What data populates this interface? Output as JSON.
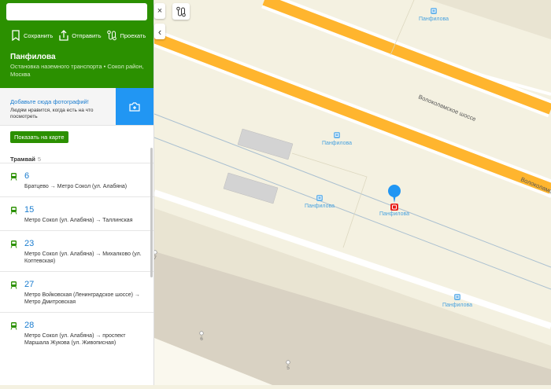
{
  "search": {
    "value": ""
  },
  "actions": [
    {
      "label": "Сохранить",
      "icon": "bookmark-icon"
    },
    {
      "label": "Отправить",
      "icon": "share-icon"
    },
    {
      "label": "Проехать",
      "icon": "route-icon"
    }
  ],
  "place": {
    "title": "Панфилова",
    "subtitle": "Остановка наземного транспорта • Сокол район, Москва"
  },
  "photo": {
    "title": "Добавьте сюда фотографий!",
    "text": "Людям нравится, когда есть на что посмотреть"
  },
  "show_on_map": "Показать на карте",
  "section": {
    "title": "Трамвай",
    "count": "5"
  },
  "routes": [
    {
      "number": "6",
      "direction": "Братцево → Метро Сокол (ул. Алабяна)"
    },
    {
      "number": "15",
      "direction": "Метро Сокол (ул. Алабяна) → Таллинская"
    },
    {
      "number": "23",
      "direction": "Метро Сокол (ул. Алабяна) → Михалково (ул. Коптевская)"
    },
    {
      "number": "27",
      "direction": "Метро Войковская (Ленинградское шоссе) → Метро Дмитровская"
    },
    {
      "number": "28",
      "direction": "Метро Сокол (ул. Алабяна) → проспект Маршала Жукова (ул. Живописная)"
    }
  ],
  "map": {
    "close": "×",
    "collapse": "‹",
    "stops": [
      "Панфилова",
      "Панфилова",
      "Панфилова",
      "Панфилова",
      "Панфилова"
    ],
    "streets": [
      "Волоколамское шоссе",
      "Волоколамск"
    ],
    "houses": [
      "7",
      "6",
      "5"
    ],
    "colors": {
      "brand": "#2b9000",
      "accent": "#2196f3",
      "road": "#ffb52e",
      "selected": "#e8201a"
    }
  }
}
